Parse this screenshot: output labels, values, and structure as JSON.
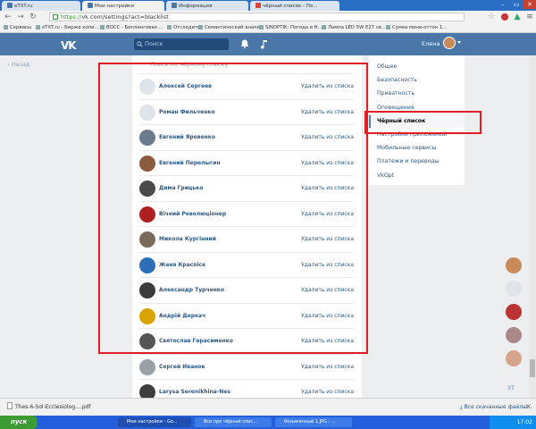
{
  "browser": {
    "tabs": [
      {
        "label": "eTXT.ru"
      },
      {
        "label": "Мои настройки"
      },
      {
        "label": "Информация"
      },
      {
        "label": "чёрный список - По..."
      }
    ],
    "window_controls": [
      "–",
      "▭",
      "✕"
    ],
    "url": {
      "scheme": "https://",
      "rest": "vk.com/settings?act=blacklist"
    },
    "bookmarks": [
      "Сервисы",
      "eTXT.ru - Биржа копи...",
      "ВОСС - Биллинговая ...",
      "Отследить",
      "Семантический анализ",
      "SINOPTIK: Погода в Н...",
      "Лампа LED 5W E27 св...",
      "Сумка мини-оттон 1..."
    ]
  },
  "vk": {
    "logo": "VK",
    "search_placeholder": "Поиск",
    "user_name": "Елена"
  },
  "leftnav": {
    "item": "Назад"
  },
  "blacklist": {
    "search_placeholder": "Поиск по чёрному списку",
    "remove_label": "Удалить из списка",
    "entries": [
      {
        "name": "Алексей Сергеев",
        "color": "#dfe3ea"
      },
      {
        "name": "Роман Фильченко",
        "color": "#dfe3ea"
      },
      {
        "name": "Евгений Яровенко",
        "color": "#6b7a8c"
      },
      {
        "name": "Евгений Перелыгин",
        "color": "#8c5a3c"
      },
      {
        "name": "Дима Грицько",
        "color": "#4a4a4a"
      },
      {
        "name": "Вічний Революціонер",
        "color": "#b02020"
      },
      {
        "name": "Микола Кургінний",
        "color": "#7a6a5a"
      },
      {
        "name": "Женя Краспіск",
        "color": "#2c6fb7"
      },
      {
        "name": "Александр Турченко",
        "color": "#3a3a3a"
      },
      {
        "name": "Андрій Деркач",
        "color": "#d9a400"
      },
      {
        "name": "Святослав Герасименко",
        "color": "#555555"
      },
      {
        "name": "Сергей Иванов",
        "color": "#9aa0a8"
      },
      {
        "name": "Larysa Serenikhina-Nes",
        "color": "#3d3d3d"
      }
    ]
  },
  "settings_menu": {
    "items": [
      {
        "label": "Общее",
        "selected": false
      },
      {
        "label": "Безопасность",
        "selected": false
      },
      {
        "label": "Приватность",
        "selected": false
      },
      {
        "label": "Оповещения",
        "selected": false
      },
      {
        "label": "Чёрный список",
        "selected": true
      },
      {
        "label": "Настройки приложений",
        "selected": false
      },
      {
        "label": "Мобильные сервисы",
        "selected": false
      },
      {
        "label": "Платежи и переводы",
        "selected": false
      },
      {
        "label": "VkOpt",
        "selected": false
      }
    ]
  },
  "sidechat": {
    "online_count": "37"
  },
  "download": {
    "file": "Thes-6-Sol-Ecclesiolog....pdf",
    "show_all": "Все скачанные файлы..."
  },
  "taskbar": {
    "start": "пуск",
    "items": [
      {
        "label": "Мои настройки - Go...",
        "active": true
      },
      {
        "label": "Все про чёрный спис...",
        "active": false
      },
      {
        "label": "безымянный 1.JPG - ...",
        "active": false
      }
    ],
    "clock": "17:02"
  },
  "colors": {
    "vk_blue": "#4a76a8",
    "highlight_red": "#e01e24",
    "link": "#2a5885"
  }
}
